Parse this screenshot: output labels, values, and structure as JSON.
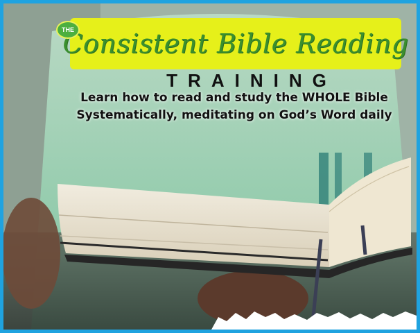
{
  "badge": "THE",
  "title": "Consistent Bible Reading",
  "training": "TRAINING",
  "subtitle_lines": [
    "Learn how to read and study the WHOLE Bible",
    "Systematically, meditating on God’s Word daily"
  ],
  "colors": {
    "border": "#1fa3e0",
    "title_bar": "#e6f01a",
    "title_text": "#3a8f2e",
    "badge": "#4caf3f"
  },
  "image": "person-holding-open-bible-photo"
}
